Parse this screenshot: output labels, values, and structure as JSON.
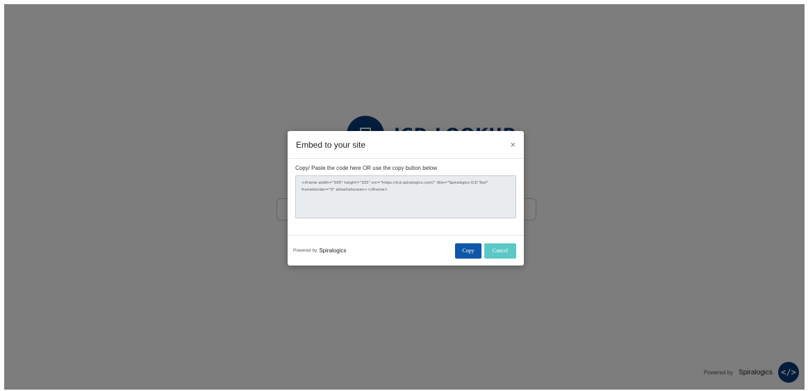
{
  "background": {
    "logo_text": "ICD LOOKUP",
    "footer_powered_by": "Powered by",
    "footer_brand": "Spiralogics",
    "embed_button_icon": "</>"
  },
  "modal": {
    "title": "Embed to your site",
    "close_icon": "×",
    "instruction": "Copy/ Paste the code here OR use the copy button below",
    "embed_code": "<iframe width=\"595\" height=\"335\" src=\"https://icd.spiralogics.com/\" title=\"Spiralogics ICD Tool\" frameborder=\"0\" allowfullscreen></iframe>",
    "footer": {
      "powered_by": "Powered by",
      "brand": "Spiralogics"
    },
    "copy_label": "Copy",
    "cancel_label": "Cancel"
  },
  "colors": {
    "brand_navy": "#0b3a78",
    "copy_button": "#0d56a8",
    "cancel_button": "#5bc8c6",
    "overlay": "rgba(0,0,0,0.5)"
  }
}
